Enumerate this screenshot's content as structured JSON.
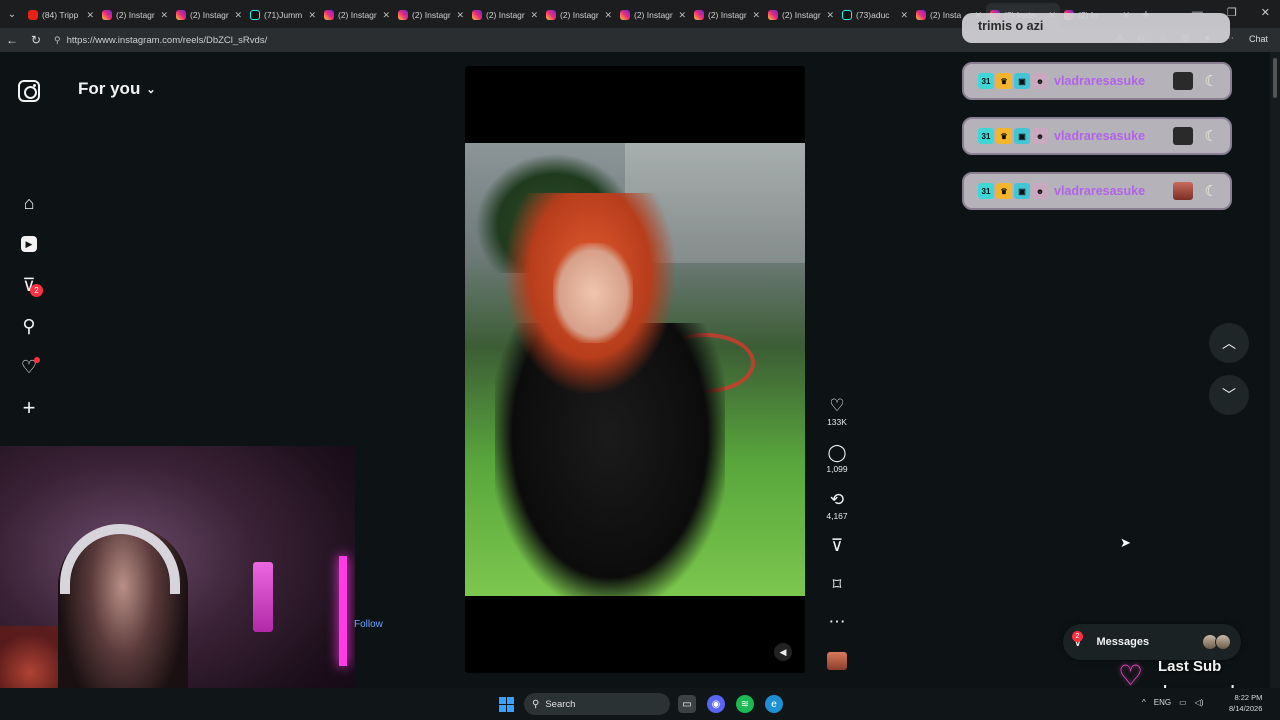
{
  "browser": {
    "tabs": [
      {
        "label": "(84) Tripp",
        "favicon": "yt"
      },
      {
        "label": "(2) Instagr",
        "favicon": "ig"
      },
      {
        "label": "(2) Instagr",
        "favicon": "ig"
      },
      {
        "label": "(71)Jumm",
        "favicon": "tt"
      },
      {
        "label": "(2) Instagr",
        "favicon": "ig"
      },
      {
        "label": "(2) Instagr",
        "favicon": "ig"
      },
      {
        "label": "(2) Instagr",
        "favicon": "ig"
      },
      {
        "label": "(2) Instagr",
        "favicon": "ig"
      },
      {
        "label": "(2) Instagr",
        "favicon": "ig"
      },
      {
        "label": "(2) Instagr",
        "favicon": "ig"
      },
      {
        "label": "(2) Instagr",
        "favicon": "ig"
      },
      {
        "label": "(73)aduc",
        "favicon": "tt"
      },
      {
        "label": "(2) Insta",
        "favicon": "ig"
      },
      {
        "label": "(2) Insta",
        "favicon": "ig"
      },
      {
        "label": "(2) In",
        "favicon": "ig"
      }
    ],
    "url": "https://www.instagram.com/reels/DbZCl_sRvds/",
    "copilot_label": "Chat"
  },
  "feed": {
    "header": "For you"
  },
  "nav": {
    "notifications_badge": "2"
  },
  "reel": {
    "likes": "133K",
    "comments": "1,099",
    "reposts": "4,167",
    "follow_label": "Follow"
  },
  "chat": {
    "top_message": "trimis o azi",
    "messages": [
      {
        "user": "vladraresasuke",
        "badge_number": "31",
        "emote": "dark"
      },
      {
        "user": "vladraresasuke",
        "badge_number": "31",
        "emote": "dark"
      },
      {
        "user": "vladraresasuke",
        "badge_number": "31",
        "emote": "red"
      }
    ],
    "user_color": "#b263e8"
  },
  "messages_pill": {
    "label": "Messages",
    "badge": "2"
  },
  "stream_overlay": {
    "last_sub_title": "Last Sub",
    "last_sub_name": "daryusraul",
    "heart_color": "#ff4fd8"
  },
  "taskbar": {
    "search_placeholder": "Search",
    "language": "ENG",
    "time": "8:22 PM",
    "date": "8/14/2026"
  }
}
